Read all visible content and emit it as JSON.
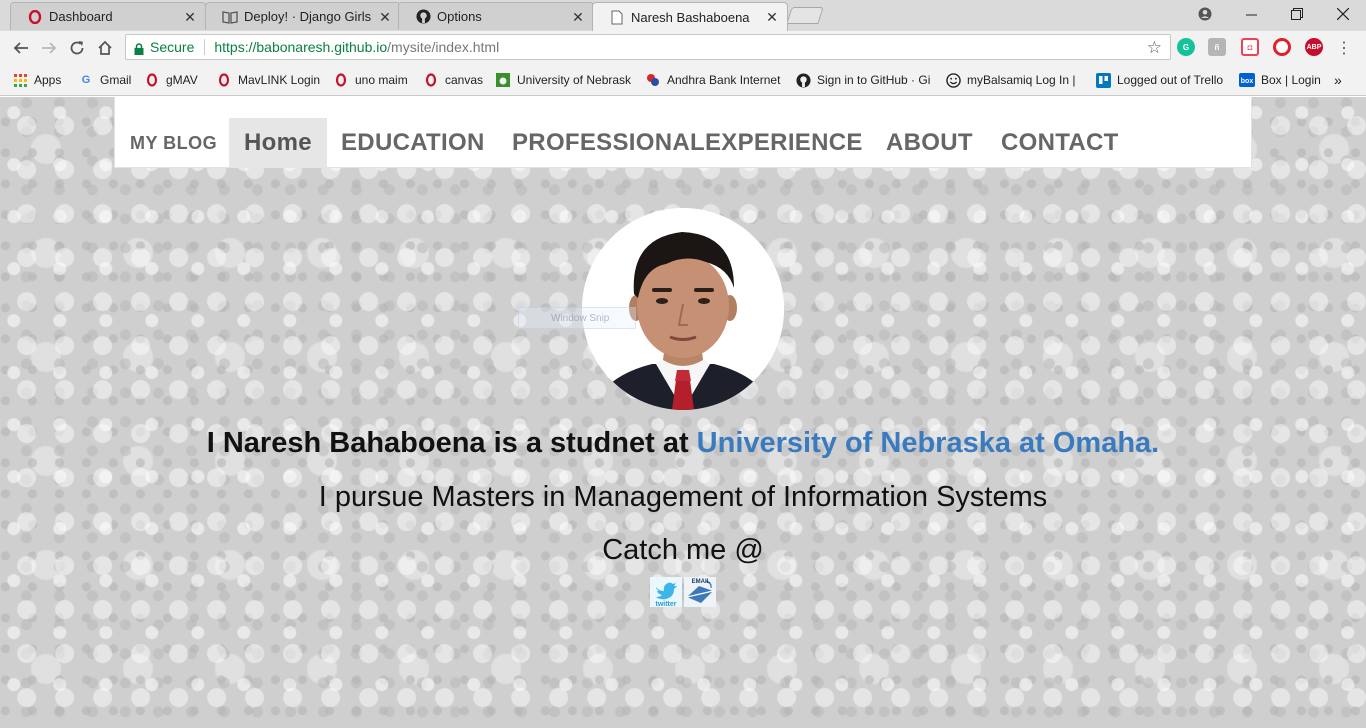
{
  "browser": {
    "tabs": [
      {
        "title": "Dashboard",
        "icon": "opera-icon"
      },
      {
        "title": "Deploy! · Django Girls Tut",
        "icon": "book-icon"
      },
      {
        "title": "Options",
        "icon": "github-icon"
      },
      {
        "title": "Naresh Bashaboena",
        "icon": "page-icon",
        "active": true
      }
    ],
    "close_glyph": "✕",
    "address": {
      "secure_label": "Secure",
      "url_host": "https://babonaresh.github.io",
      "url_path": "/mysite/index.html"
    },
    "extensions": [
      {
        "name": "grammarly-icon",
        "label": "G",
        "color": "#15c39a"
      },
      {
        "name": "extension-icon",
        "label": "ñ",
        "color": "#b5b5b5"
      },
      {
        "name": "pocket-icon",
        "label": "◘",
        "color": "#ef4056"
      },
      {
        "name": "opera-extension-icon",
        "label": "O",
        "color": "#e0202a"
      },
      {
        "name": "adblock-plus-icon",
        "label": "ABP",
        "color": "#c70d2c"
      }
    ],
    "bookmarks": [
      {
        "label": "Apps",
        "icon": "apps-grid-icon"
      },
      {
        "label": "Gmail",
        "icon": "google-icon"
      },
      {
        "label": "gMAV",
        "icon": "opera-icon"
      },
      {
        "label": "MavLINK Login",
        "icon": "opera-icon"
      },
      {
        "label": "uno maim",
        "icon": "opera-icon"
      },
      {
        "label": "canvas",
        "icon": "opera-icon"
      },
      {
        "label": "University of Nebrask",
        "icon": "unl-icon"
      },
      {
        "label": "Andhra Bank Internet",
        "icon": "andhra-bank-icon"
      },
      {
        "label": "Sign in to GitHub · Gi",
        "icon": "github-icon"
      },
      {
        "label": "myBalsamiq Log In |",
        "icon": "smiley-icon"
      },
      {
        "label": "Logged out of Trello",
        "icon": "trello-icon"
      },
      {
        "label": "Box | Login",
        "icon": "box-icon"
      }
    ],
    "overflow_glyph": "»"
  },
  "site": {
    "brand": "MY BLOG",
    "nav": [
      {
        "label": "Home",
        "active": true
      },
      {
        "label": "EDUCATION"
      },
      {
        "label": "PROFESSIONALEXPERIENCE"
      },
      {
        "label": "ABOUT"
      },
      {
        "label": "CONTACT"
      }
    ],
    "intro_prefix": "I Naresh Bahaboena is a studnet at ",
    "intro_university": "University of Nebraska at Omaha.",
    "line2": "I pursue Masters in Management of Information Systems",
    "line3": "Catch me @",
    "social": [
      {
        "name": "twitter-link",
        "label": "twitter",
        "color": "#3cb6e8"
      },
      {
        "name": "email-link",
        "label": "EMAIL",
        "color": "#3d79b8"
      }
    ],
    "overlay_text": "Window Snip"
  }
}
